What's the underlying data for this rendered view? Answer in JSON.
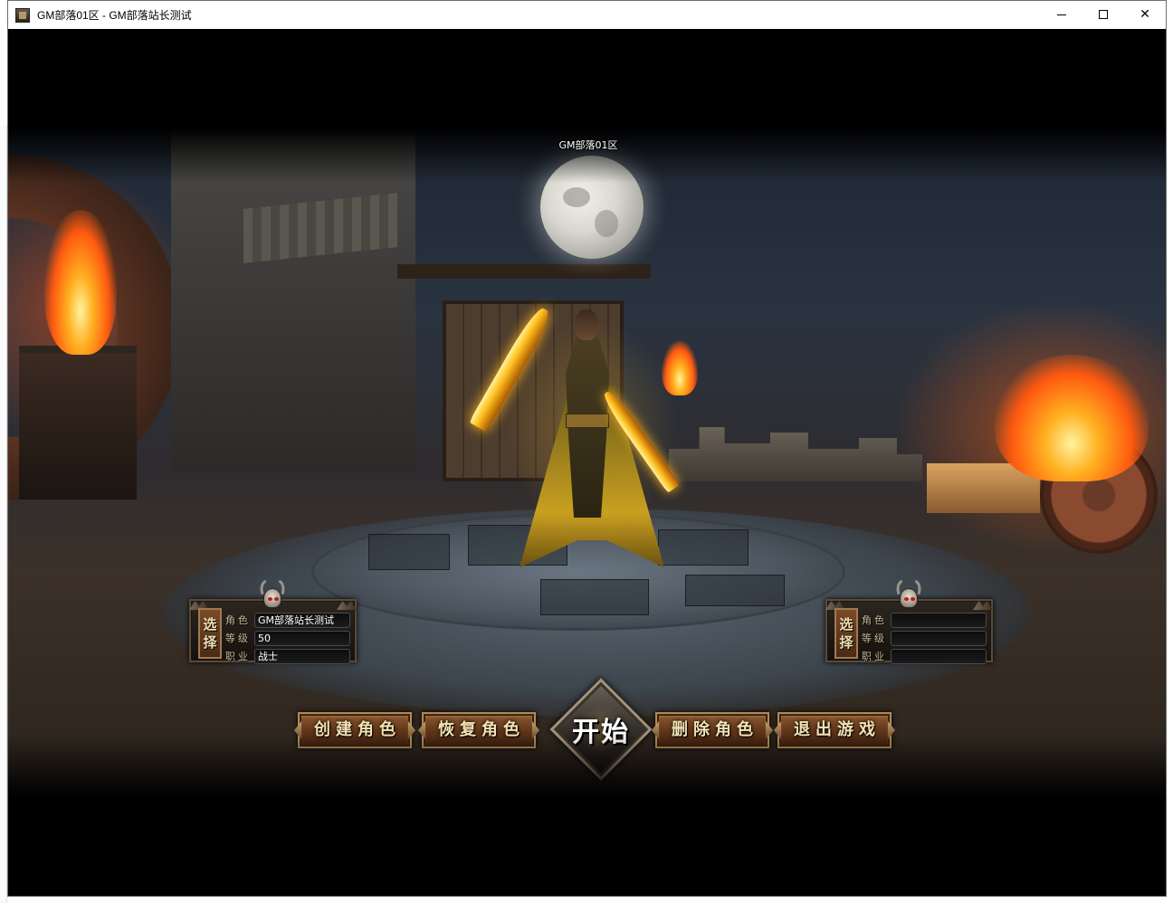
{
  "window": {
    "title": "GM部落01区 - GM部落站长测试",
    "icon": "game-app-icon",
    "controls": {
      "minimize": "—",
      "maximize": "☐",
      "close": "✕"
    }
  },
  "game": {
    "server_name": "GM部落01区",
    "left_panel": {
      "select_label_top": "选",
      "select_label_bottom": "择",
      "labels": {
        "role": "角色",
        "level": "等级",
        "class": "职业"
      },
      "values": {
        "role": "GM部落站长测试",
        "level": "50",
        "class": "战士"
      }
    },
    "right_panel": {
      "select_label_top": "选",
      "select_label_bottom": "择",
      "labels": {
        "role": "角色",
        "level": "等级",
        "class": "职业"
      },
      "values": {
        "role": "",
        "level": "",
        "class": ""
      }
    },
    "buttons": {
      "create": "创建角色",
      "restore": "恢复角色",
      "start": "开始",
      "delete": "删除角色",
      "exit": "退出游戏"
    }
  },
  "colors": {
    "button_gold": "#f4e2b4",
    "button_brown": "#5e3418",
    "fire": "#ff5a10",
    "moon": "#d8d8d0"
  }
}
